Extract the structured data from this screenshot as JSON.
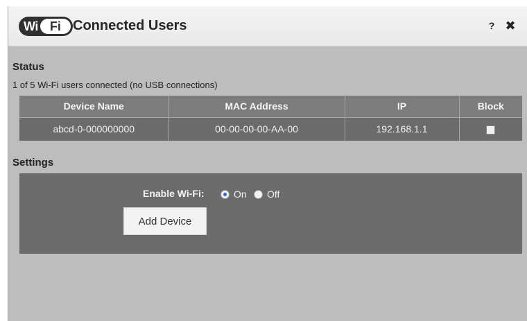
{
  "header": {
    "logo": {
      "wi": "Wi",
      "fi": "Fi"
    },
    "title": "Connected Users",
    "help_label": "?",
    "close_label": "✖"
  },
  "status": {
    "heading": "Status",
    "summary": "1 of 5 Wi-Fi users connected (no USB connections)"
  },
  "table": {
    "columns": [
      "Device Name",
      "MAC Address",
      "IP",
      "Block"
    ],
    "rows": [
      {
        "device_name": "abcd-0-000000000",
        "mac": "00-00-00-00-AA-00",
        "ip": "192.168.1.1",
        "blocked": false
      }
    ]
  },
  "settings": {
    "heading": "Settings",
    "enable_wifi_label": "Enable Wi-Fi:",
    "options": [
      "On",
      "Off"
    ],
    "selected": "On",
    "add_device_label": "Add Device"
  },
  "colors": {
    "panel_bg": "#bdbdbd",
    "table_header_bg": "#7c7c7c",
    "table_row_bg": "#6b6b6b",
    "radio_selected": "#2a6cc9"
  }
}
